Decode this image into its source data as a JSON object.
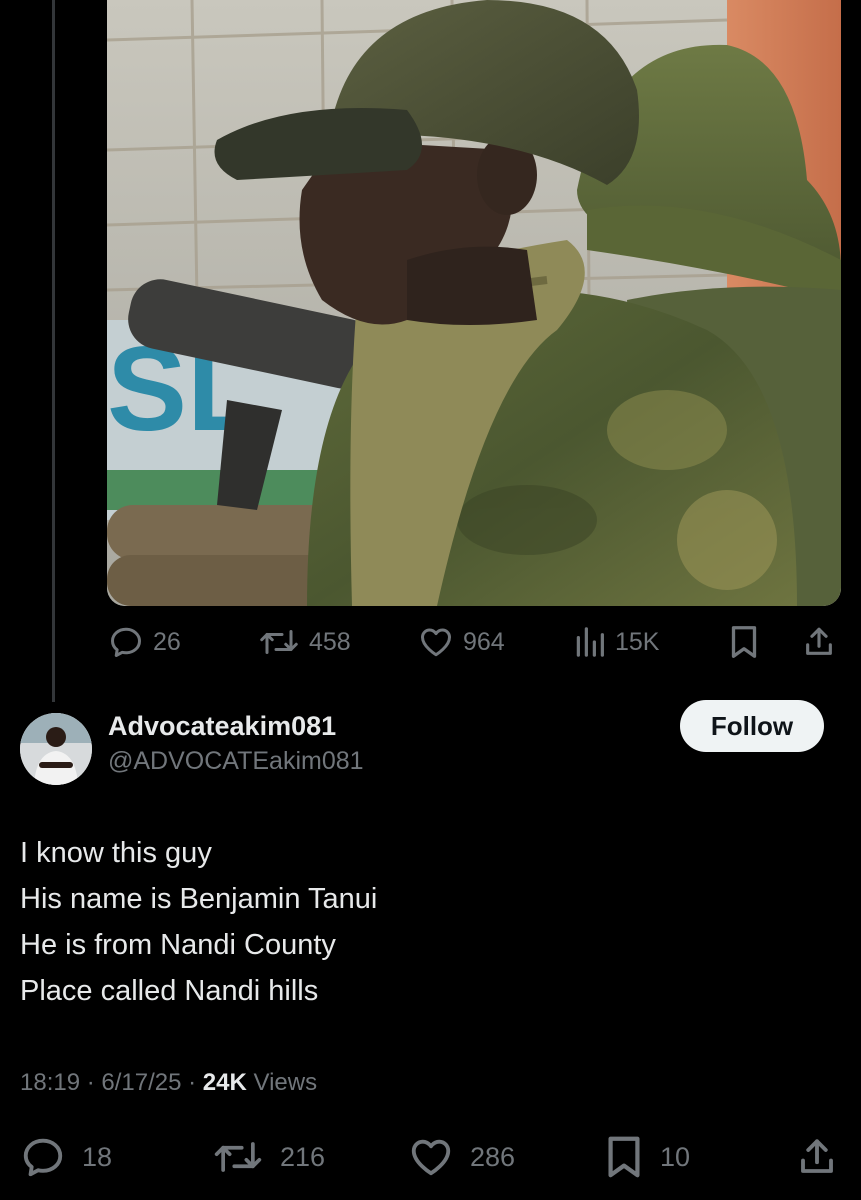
{
  "media": {
    "sign_text": "SL"
  },
  "tweet_actions": {
    "replies": "26",
    "reposts": "458",
    "likes": "964",
    "views": "15K"
  },
  "reply": {
    "display_name": "Advocateakim081",
    "handle": "@ADVOCATEakim081",
    "follow_label": "Follow",
    "text_lines": [
      "I know this guy",
      "His name is Benjamin Tanui",
      "He is from Nandi County",
      "Place called Nandi hills"
    ],
    "meta": {
      "time": "18:19",
      "separator": " · ",
      "date": "6/17/25",
      "views_count": "24K",
      "views_label": "Views"
    },
    "actions": {
      "replies": "18",
      "reposts": "216",
      "likes": "286",
      "bookmarks": "10"
    }
  },
  "icons": {
    "reply": "reply-icon",
    "repost": "repost-icon",
    "like": "heart-icon",
    "views": "analytics-icon",
    "bookmark": "bookmark-icon",
    "share": "share-icon"
  },
  "colors": {
    "background": "#000000",
    "text_primary": "#e7e9ea",
    "text_secondary": "#71767b",
    "follow_button_bg": "#eff3f4",
    "follow_button_text": "#0f1419",
    "thread_line": "#333639"
  }
}
